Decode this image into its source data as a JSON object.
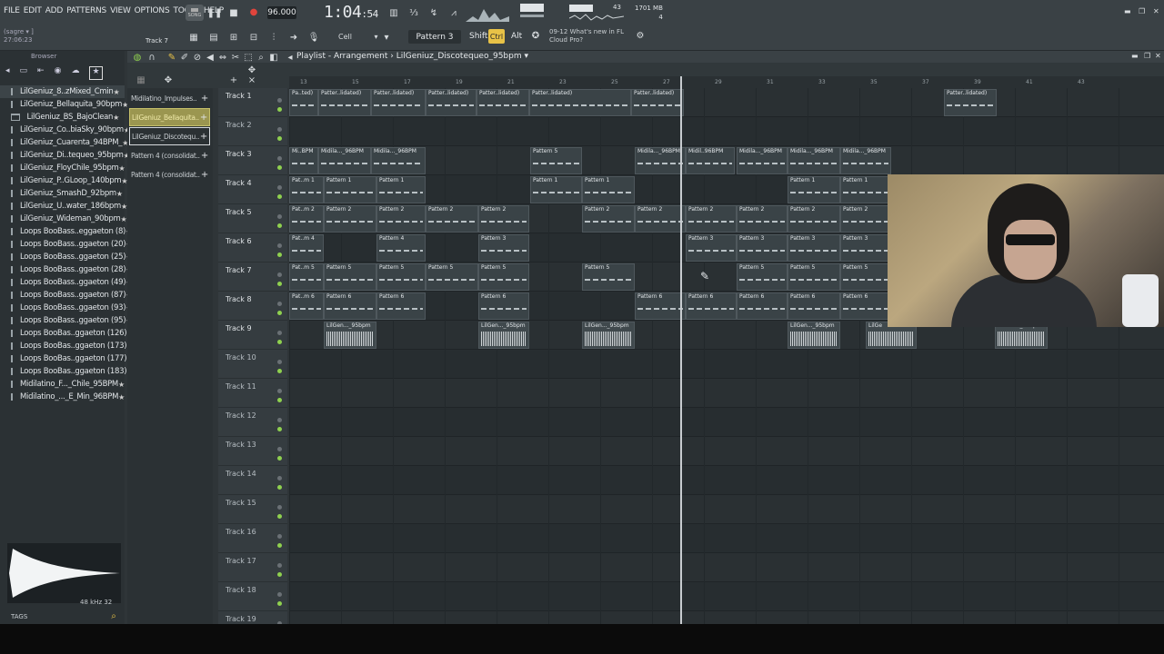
{
  "menu": [
    "FILE",
    "EDIT",
    "ADD",
    "PATTERNS",
    "VIEW",
    "OPTIONS",
    "TOOLS",
    "HELP"
  ],
  "hint": {
    "line1": "(sagre ▾ ]",
    "line2": "27:06:23",
    "track_hint": "Track 7"
  },
  "transport": {
    "mode": "SONG",
    "tempo": "96.000",
    "time_main": "1:04",
    "time_small": ":54"
  },
  "cpu": {
    "mem": "1701 MB",
    "poly": "43",
    "voices": "4"
  },
  "news": {
    "line1": "09-12  What's new in FL",
    "line2": "Cloud Pro?"
  },
  "toolbar": {
    "pattern": "Pattern 3",
    "snap": "Cell",
    "shift": "Shift",
    "ctrl": "Ctrl",
    "alt": "Alt"
  },
  "browser": {
    "title": "Browser",
    "items": [
      "LilGeniuz_8..zMixed_Cmin",
      "LilGeniuz_Bellaquita_90bpm",
      "LilGeniuz_BS_BajoClean",
      "LilGeniuz_Co..biaSky_90bpm",
      "LilGeniuz_Cuarenta_94BPM_",
      "LilGeniuz_Di..tequeo_95bpm",
      "LilGeniuz_FloyChile_95bpm",
      "LilGeniuz_P..GLoop_140bpm",
      "LilGeniuz_SmashD_92bpm",
      "LilGeniuz_U..water_186bpm",
      "LilGeniuz_Wideman_90bpm",
      "Loops BooBass..eggaeton (8)",
      "Loops BooBass..ggaeton (20)",
      "Loops BooBass..ggaeton (25)",
      "Loops BooBass..ggaeton (28)",
      "Loops BooBass..ggaeton (49)",
      "Loops BooBass..ggaeton (87)",
      "Loops BooBass..ggaeton (93)",
      "Loops BooBass..ggaeton (95)",
      "Loops BooBas..ggaeton (126)",
      "Loops BooBas..ggaeton (173)",
      "Loops BooBas..ggaeton (177)",
      "Loops BooBas..ggaeton (183)",
      "Midilatino_F..._Chile_95BPM",
      "Midilatino_..._E_Min_96BPM"
    ],
    "sample_rate": "48 kHz 32",
    "tags": "TAGS"
  },
  "playlist": {
    "title": "Playlist - Arrangement",
    "arrangement": "LilGeniuz_Discotequeo_95bpm",
    "picker": [
      "Midilatino_Impulses..",
      "LilGeniuz_Bellaquita..",
      "LilGeniuz_Discotequ..",
      "Pattern 4 (consolidat..",
      "Pattern 4 (consolidat.."
    ],
    "ruler": [
      "13",
      "15",
      "17",
      "19",
      "21",
      "23",
      "25",
      "27",
      "29",
      "31",
      "33",
      "35",
      "37",
      "39",
      "41",
      "43"
    ],
    "tracks": [
      "Track 1",
      "Track 2",
      "Track 3",
      "Track 4",
      "Track 5",
      "Track 6",
      "Track 7",
      "Track 8",
      "Track 9",
      "Track 10",
      "Track 11",
      "Track 12",
      "Track 13",
      "Track 14",
      "Track 15",
      "Track 16",
      "Track 17",
      "Track 18",
      "Track 19"
    ],
    "clip_labels": {
      "t1": [
        "Pa..ted)",
        "Patter..lidated)",
        "Patter..lidated)",
        "Patter..lidated)",
        "Patter..lidated)",
        "Patter..lidated)",
        "Patter..lidated)",
        "Patter..lidated)"
      ],
      "t3": [
        "Mi..BPM",
        "Midila..._96BPM",
        "Midila..._96BPM",
        "Pattern 5",
        "Midila..._96BPM",
        "Midil..96BPM",
        "Midila..._96BPM",
        "Midila..._96BPM",
        "Midila..._96BPM"
      ],
      "pattern1": "Pattern 1",
      "pattern2": "Pattern 2",
      "pattern3": "Pattern 3",
      "pattern4": "Pattern 4",
      "pattern5": "Pattern 5",
      "pattern6": "Pattern 6",
      "pat_m1": "Pat..m 1",
      "pat_m2": "Pat..m 2",
      "pat_m4": "Pat..m 4",
      "pat_m5": "Pat..m 5",
      "pat_m6": "Pat..m 6",
      "audio": "LilGen..._95bpm",
      "audio_short": "LilGe"
    }
  }
}
